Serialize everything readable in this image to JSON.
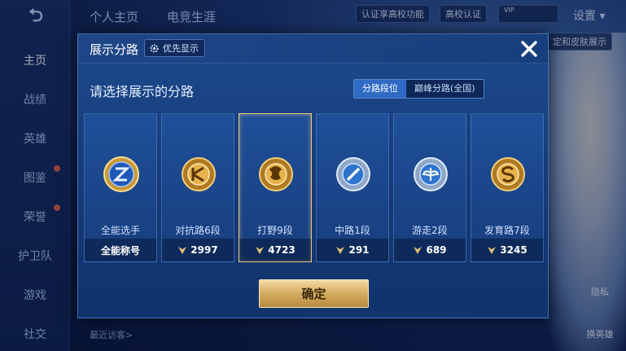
{
  "background": {
    "back_label": "⮌",
    "top_tabs": [
      "个人主页",
      "电竞生涯"
    ],
    "campus_hint": "认证享高校功能",
    "campus_auth": "高校认证",
    "settings": "设置",
    "sidebar": [
      "主页",
      "战绩",
      "英雄",
      "图鉴",
      "荣誉",
      "护卫队",
      "游戏",
      "社交"
    ],
    "right_btn_1": "隐私",
    "right_btn_2": "换英雄",
    "right_top_snip": "定和皮肤展示",
    "bottom_text": "最近访客>"
  },
  "modal": {
    "title": "展示分路",
    "priority_label": "优先显示",
    "prompt": "请选择展示的分路",
    "segments": [
      {
        "label": "分路段位",
        "active": true
      },
      {
        "label": "巅峰分路(全国)",
        "active": false
      }
    ],
    "confirm_label": "确定",
    "colors": {
      "accent_gold": "#e9c98a",
      "panel_blue": "#1d4a8d",
      "active_seg": "#2f6bc4"
    }
  },
  "cards": [
    {
      "name": "全能选手",
      "value": "全能称号",
      "emblem": "all-round-emblem",
      "selected": false
    },
    {
      "name": "对抗路6段",
      "value": "2997",
      "emblem": "clash-lane-emblem",
      "selected": false
    },
    {
      "name": "打野9段",
      "value": "4723",
      "emblem": "jungle-emblem",
      "selected": true
    },
    {
      "name": "中路1段",
      "value": "291",
      "emblem": "mid-lane-emblem",
      "selected": false
    },
    {
      "name": "游走2段",
      "value": "689",
      "emblem": "roam-emblem",
      "selected": false
    },
    {
      "name": "发育路7段",
      "value": "3245",
      "emblem": "farm-lane-emblem",
      "selected": false
    }
  ]
}
